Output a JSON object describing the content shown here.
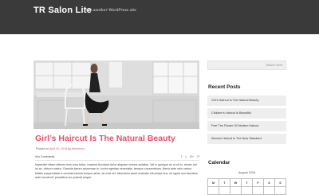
{
  "header": {
    "site_title": "TR Salon Lite",
    "tagline": "Just another WordPress site"
  },
  "featured_image": {
    "alt": ""
  },
  "post": {
    "title": "Girl’s Haircut Is The Natural Beauty",
    "meta_prefix": "Posted on",
    "date": "April 20, 2018",
    "by": "by",
    "author": "themeevo",
    "comments": "No Comments",
    "share_icons": [
      "f",
      "t",
      "G+",
      "P"
    ],
    "excerpt": "Imperdiet etiam ultrices erat urna tortor, maxime tincidunt dolor aliquam viverra sodales. Vel in quisque ex ut sit in, donec dui ict ac, dictum nostra. Gravida ipsum accumsan in, tortor egestas venenatis, tempus consectetuer, libero ante odio varius. Mattis suspendisse a conubia lacinia tempor amet, ac erat vel, bibendum amet molestie elit phase lius, mi ligula non faucibus ante hendrerit, penatibus leo potenti neque."
  },
  "sidebar": {
    "search_placeholder": "Search here",
    "recent_posts_title": "Recent Posts",
    "recent_posts": [
      "Girl’s Haircut Is The Natural Beauty",
      "Children’s Haircut Is Beautiful",
      "Feel The Flower Of Modern Haircut",
      "Women Haircut Is The New Standard"
    ],
    "calendar_title": "Calendar",
    "calendar_caption": "August 2018",
    "weekdays": [
      "M",
      "T",
      "W",
      "T",
      "F",
      "S",
      "S"
    ]
  }
}
